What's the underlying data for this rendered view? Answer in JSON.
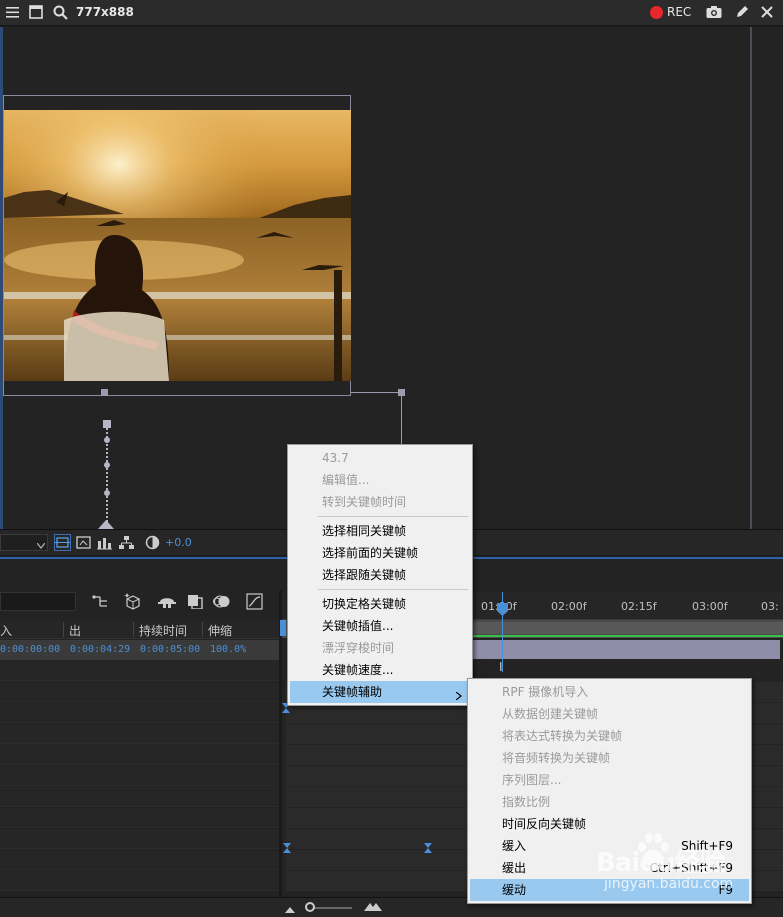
{
  "topbar": {
    "resolution": "777x888",
    "rec_label": "REC",
    "rec_color": "#e8272d",
    "icons": [
      "hamburger-icon",
      "window-icon",
      "zoom-icon",
      "record-icon",
      "camera-icon",
      "pencil-icon",
      "close-icon"
    ]
  },
  "viewer": {
    "zoom_value": "+0.0"
  },
  "timeline": {
    "columns": [
      "入",
      "出",
      "持续时间",
      "伸缩"
    ],
    "layer": {
      "in": "0:00:00:00",
      "out": "0:00:04:29",
      "duration": "0:00:05:00",
      "stretch": "100.0%"
    },
    "ruler": [
      "01:00f",
      "02:00f",
      "02:15f",
      "03:00f",
      "03:"
    ],
    "accent": "#2f61a8"
  },
  "context_menu": {
    "items": [
      {
        "label": "43.7",
        "disabled": true
      },
      {
        "label": "编辑值...",
        "disabled": true
      },
      {
        "label": "转到关键帧时间",
        "disabled": true
      },
      {
        "label": "选择相同关键帧",
        "disabled": false
      },
      {
        "label": "选择前面的关键帧",
        "disabled": false
      },
      {
        "label": "选择跟随关键帧",
        "disabled": false
      },
      {
        "label": "切换定格关键帧",
        "disabled": false
      },
      {
        "label": "关键帧插值...",
        "disabled": false
      },
      {
        "label": "漂浮穿梭时间",
        "disabled": true
      },
      {
        "label": "关键帧速度...",
        "disabled": false
      },
      {
        "label": "关键帧辅助",
        "disabled": false
      }
    ]
  },
  "submenu": {
    "items": [
      {
        "label": "RPF 摄像机导入",
        "disabled": true,
        "shortcut": ""
      },
      {
        "label": "从数据创建关键帧",
        "disabled": true,
        "shortcut": ""
      },
      {
        "label": "将表达式转换为关键帧",
        "disabled": true,
        "shortcut": ""
      },
      {
        "label": "将音频转换为关键帧",
        "disabled": true,
        "shortcut": ""
      },
      {
        "label": "序列图层...",
        "disabled": true,
        "shortcut": ""
      },
      {
        "label": "指数比例",
        "disabled": true,
        "shortcut": ""
      },
      {
        "label": "时间反向关键帧",
        "disabled": false,
        "shortcut": ""
      },
      {
        "label": "缓入",
        "disabled": false,
        "shortcut": "Shift+F9"
      },
      {
        "label": "缓出",
        "disabled": false,
        "shortcut": "Ctrl+Shift+F9"
      },
      {
        "label": "缓动",
        "disabled": false,
        "shortcut": "F9"
      }
    ]
  },
  "watermark": {
    "line1": "Baidu经验",
    "line2": "jingyan.baidu.com"
  }
}
